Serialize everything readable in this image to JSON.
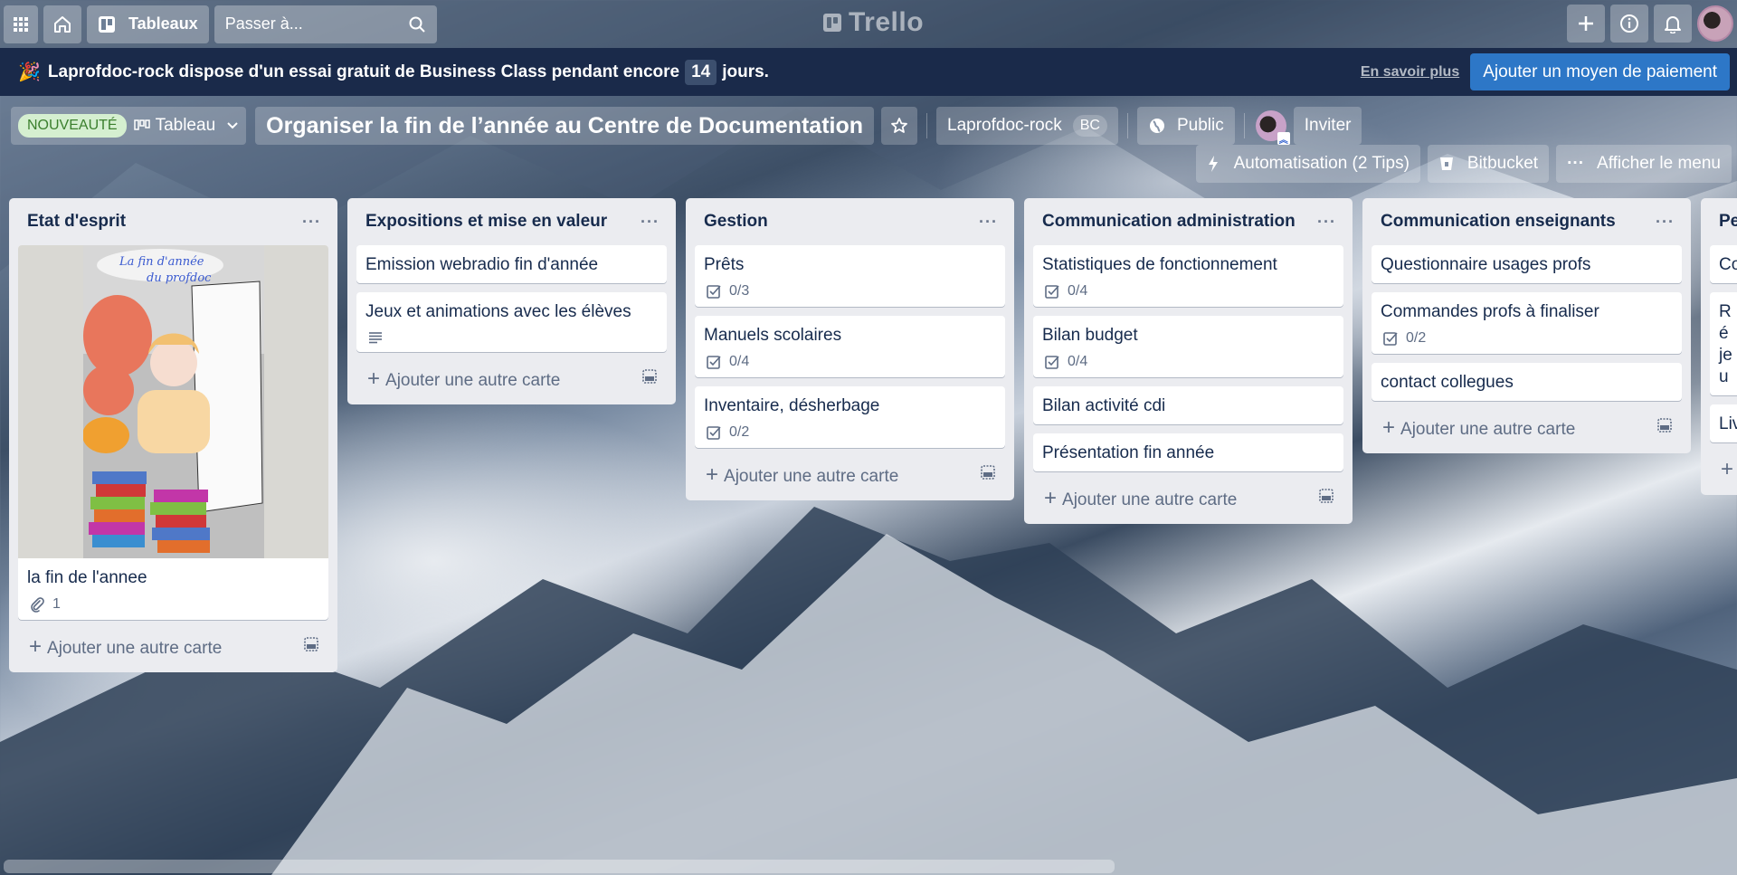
{
  "topnav": {
    "apps_icon": "grid-icon",
    "home_icon": "home-icon",
    "boards_label": "Tableaux",
    "search_placeholder": "Passer à...",
    "logo_text": "Trello",
    "right_icons": [
      "plus-icon",
      "info-icon",
      "bell-icon",
      "avatar"
    ]
  },
  "banner": {
    "emoji": "🎉",
    "text_before": "Laprofdoc-rock dispose d'un essai gratuit de Business Class pendant encore",
    "days": "14",
    "text_after": "jours.",
    "learn_more": "En savoir plus",
    "cta": "Ajouter un moyen de paiement"
  },
  "board_header": {
    "new_badge": "NOUVEAUTÉ",
    "view_label": "Tableau",
    "title": "Organiser la fin de l’année au Centre de Documentation",
    "workspace": "Laprofdoc-rock",
    "workspace_badge": "BC",
    "visibility": "Public",
    "invite": "Inviter",
    "automation": "Automatisation (2 Tips)",
    "bitbucket": "Bitbucket",
    "menu": "Afficher le menu"
  },
  "add_card_label": "Ajouter une autre carte",
  "lists": [
    {
      "title": "Etat d'esprit",
      "cards": [
        {
          "title": "la fin de l'annee",
          "cover": true,
          "attachments": "1"
        }
      ]
    },
    {
      "title": "Expositions et mise en valeur",
      "cards": [
        {
          "title": "Emission webradio fin d'année"
        },
        {
          "title": "Jeux et animations avec les élèves",
          "description": true
        }
      ]
    },
    {
      "title": "Gestion",
      "cards": [
        {
          "title": "Prêts",
          "checklist": "0/3"
        },
        {
          "title": "Manuels scolaires",
          "checklist": "0/4"
        },
        {
          "title": "Inventaire, désherbage",
          "checklist": "0/2"
        }
      ]
    },
    {
      "title": "Communication administration",
      "cards": [
        {
          "title": "Statistiques de fonctionnement",
          "checklist": "0/4"
        },
        {
          "title": "Bilan budget",
          "checklist": "0/4"
        },
        {
          "title": "Bilan activité cdi"
        },
        {
          "title": "Présentation fin année"
        }
      ]
    },
    {
      "title": "Communication enseignants",
      "cards": [
        {
          "title": "Questionnaire usages profs"
        },
        {
          "title": "Commandes profs à finaliser",
          "checklist": "0/2"
        },
        {
          "title": "contact collegues"
        }
      ]
    },
    {
      "title": "Pe",
      "cards": [
        {
          "title": "Co"
        },
        {
          "title": "Ré jeu"
        },
        {
          "title": "Liv"
        }
      ]
    }
  ]
}
